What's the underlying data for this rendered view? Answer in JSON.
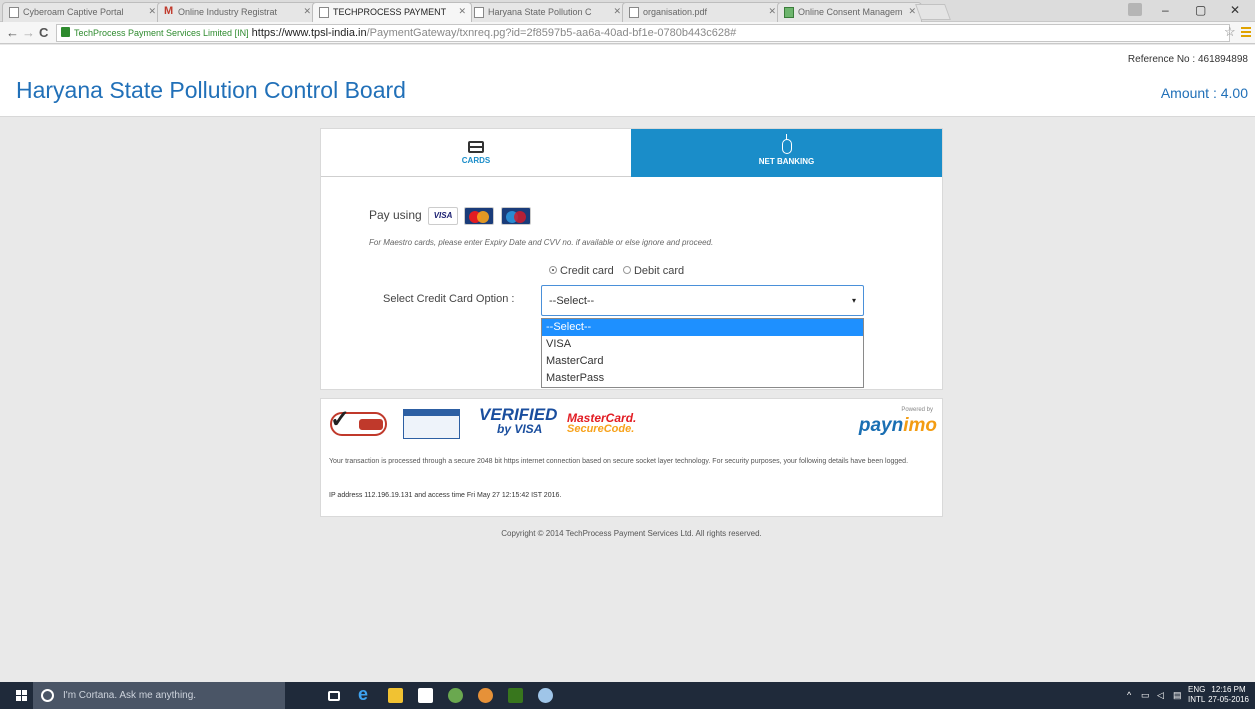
{
  "browser": {
    "tabs": [
      {
        "title": "Cyberoam Captive Portal",
        "icon": "page-icon"
      },
      {
        "title": "Online Industry Registrat",
        "icon": "gmail-icon"
      },
      {
        "title": "TECHPROCESS PAYMENT",
        "icon": "page-icon",
        "active": true
      },
      {
        "title": "Haryana State Pollution C",
        "icon": "page-icon"
      },
      {
        "title": "organisation.pdf",
        "icon": "page-icon"
      },
      {
        "title": "Online Consent Managem",
        "icon": "app-icon"
      }
    ],
    "close_glyph": "✕",
    "window_controls": {
      "minimize": "–",
      "maximize": "▢",
      "close": "✕"
    },
    "nav": {
      "back": "←",
      "forward": "→",
      "reload": "C"
    },
    "address": {
      "ev_label": "TechProcess Payment Services Limited [IN]",
      "url_scheme_host": "https://www.tpsl-india.in",
      "url_path": "/PaymentGateway/txnreq.pg?id=2f8597b5-aa6a-40ad-bf1e-0780b443c628#"
    },
    "star_glyph": "☆"
  },
  "header": {
    "title": "Haryana State Pollution Control Board",
    "reference_label": "Reference No : 461894898",
    "amount_label": "Amount : 4.00",
    "accent_color": "#2170b8"
  },
  "payment": {
    "tabs": {
      "cards": "CARDS",
      "net_banking": "NET BANKING"
    },
    "active_tab": "net_banking",
    "pay_using_label": "Pay using",
    "card_brands": {
      "visa": "VISA",
      "mastercard": "mastercard",
      "maestro": "maestro"
    },
    "maestro_note": "For Maestro cards, please enter Expiry Date and CVV no. if available or else ignore and proceed.",
    "card_types": [
      {
        "label": "Credit card",
        "selected": true
      },
      {
        "label": "Debit card",
        "selected": false
      }
    ],
    "select_label": "Select Credit Card Option :",
    "select_value": "--Select--",
    "select_caret": "▾",
    "options": [
      "--Select--",
      "VISA",
      "MasterCard",
      "MasterPass"
    ],
    "highlighted_option": "--Select--"
  },
  "trust": {
    "verified_line1": "VERIFIED",
    "verified_line2": "by VISA",
    "mc_secure_line1": "MasterCard.",
    "mc_secure_line2": "SecureCode.",
    "powered_by": "Powered by",
    "paynimo_brand": "payn",
    "paynimo_tail": "imo",
    "note": "Your transaction is processed through a secure 2048 bit https internet connection based on secure socket layer technology. For security purposes, your following details have been logged.",
    "ip_line": "IP address 112.196.19.131 and access time Fri May 27 12:15:42 IST 2016."
  },
  "footer": {
    "copyright": "Copyright © 2014 TechProcess Payment Services Ltd. All rights reserved."
  },
  "taskbar": {
    "cortana_placeholder": "I'm Cortana. Ask me anything.",
    "language": "ENG",
    "layout": "INTL",
    "time": "12:16 PM",
    "date": "27-05-2016"
  }
}
